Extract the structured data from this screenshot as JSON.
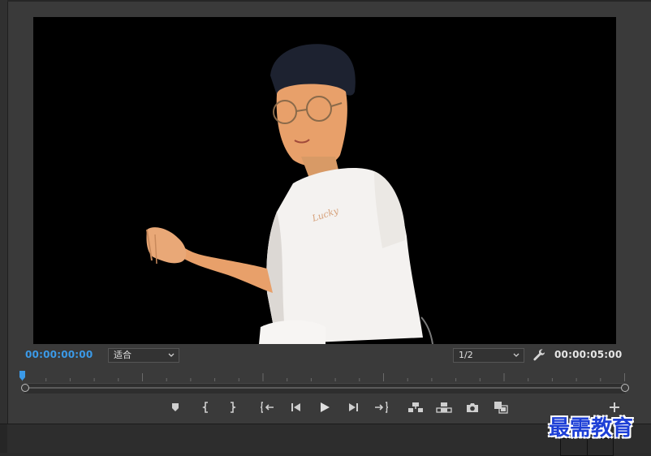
{
  "monitor": {
    "current_timecode": "00:00:00:00",
    "duration_timecode": "00:00:05:00",
    "zoom_select": {
      "selected": "适合"
    },
    "resolution_select": {
      "selected": "1/2"
    }
  },
  "transport": {
    "buttons": [
      "add-marker",
      "mark-in",
      "mark-out",
      "go-to-in",
      "step-back",
      "play",
      "step-forward",
      "go-to-out",
      "insert",
      "overwrite",
      "export-frame",
      "comparison-view"
    ]
  },
  "watermark": {
    "text": "最需教育"
  },
  "colors": {
    "timecode_accent": "#3b9ae8",
    "panel_bg": "#3a3a3a",
    "viewer_bg": "#000000",
    "watermark": "#1d3fd6"
  }
}
